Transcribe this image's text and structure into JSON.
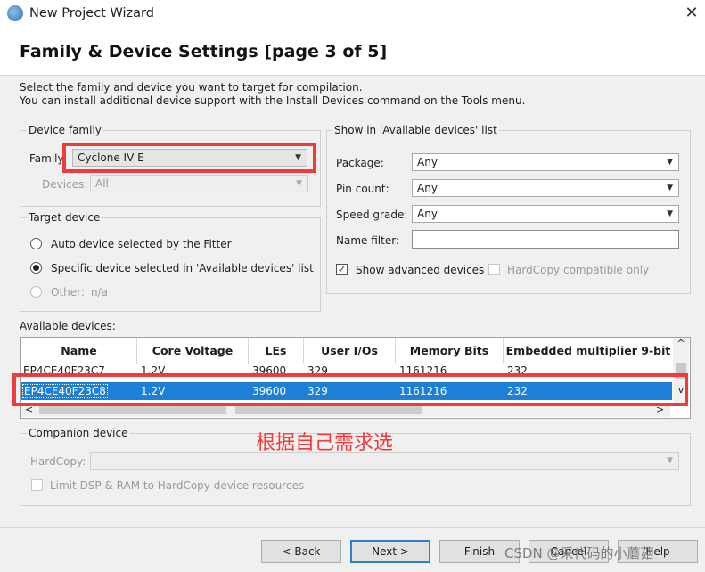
{
  "window": {
    "title": "New Project Wizard",
    "close_glyph": "✕"
  },
  "header": {
    "title": "Family & Device Settings [page 3 of 5]",
    "desc_line1": "Select the family and device you want to target for compilation.",
    "desc_line2": "You can install additional device support with the Install Devices command on the Tools menu."
  },
  "device_family": {
    "group_label": "Device family",
    "family_label": "Family",
    "family_value": "Cyclone IV E",
    "devices_label": "Devices:",
    "devices_value": "All"
  },
  "target_device": {
    "group_label": "Target device",
    "auto_label": "Auto device selected by the Fitter",
    "specific_label": "Specific device selected in 'Available devices' list",
    "other_label": "Other:",
    "other_value": "n/a"
  },
  "show_list": {
    "group_label": "Show in 'Available devices' list",
    "package_label": "Package:",
    "package_value": "Any",
    "pin_label": "Pin count:",
    "pin_value": "Any",
    "speed_label": "Speed grade:",
    "speed_value": "Any",
    "name_filter_label": "Name filter:",
    "name_filter_value": "",
    "show_advanced_label": "Show advanced devices",
    "show_advanced_checked": true,
    "hardcopy_label": "HardCopy compatible only"
  },
  "available": {
    "label": "Available devices:",
    "columns": [
      "Name",
      "Core Voltage",
      "LEs",
      "User I/Os",
      "Memory Bits",
      "Embedded multiplier 9-bit"
    ],
    "rows": [
      [
        "EP4CE40F23C7",
        "1.2V",
        "39600",
        "329",
        "1161216",
        "232"
      ],
      [
        "EP4CE40F23C8",
        "1.2V",
        "39600",
        "329",
        "1161216",
        "232"
      ]
    ],
    "selected_row": 1,
    "scroll_up": "^",
    "scroll_down": "v",
    "scroll_left": "<",
    "scroll_right": ">"
  },
  "companion": {
    "group_label": "Companion device",
    "hardcopy_label": "HardCopy:",
    "limit_label": "Limit DSP & RAM to HardCopy device resources"
  },
  "annotation": "根据自己需求选",
  "buttons": {
    "back": "< Back",
    "next": "Next >",
    "finish": "Finish",
    "cancel": "Cancel",
    "help": "Help"
  },
  "watermark": "CSDN @采代码的小蘑菇",
  "colors": {
    "highlight": "#ef3b3b",
    "selection": "#1e7fd6"
  }
}
